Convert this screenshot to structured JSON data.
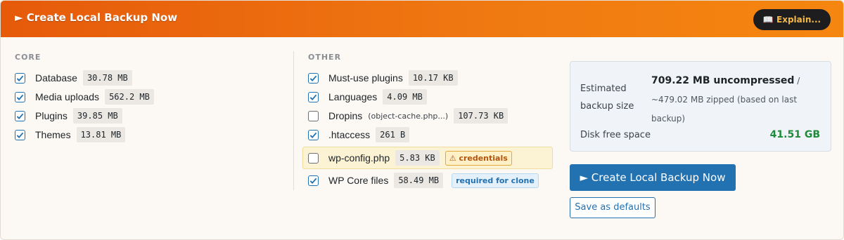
{
  "header": {
    "title": "Create Local Backup Now",
    "title_icon": "play-triangle",
    "explain_label": "Explain...",
    "explain_icon": "book-icon"
  },
  "core": {
    "heading": "CORE",
    "items": [
      {
        "label": "Database",
        "size": "30.78 MB",
        "checked": true
      },
      {
        "label": "Media uploads",
        "size": "562.2 MB",
        "checked": true
      },
      {
        "label": "Plugins",
        "size": "39.85 MB",
        "checked": true
      },
      {
        "label": "Themes",
        "size": "13.81 MB",
        "checked": true
      }
    ]
  },
  "other": {
    "heading": "OTHER",
    "items": [
      {
        "label": "Must-use plugins",
        "size": "10.17 KB",
        "checked": true
      },
      {
        "label": "Languages",
        "size": "4.09 MB",
        "checked": true
      },
      {
        "label": "Dropins",
        "sub": "(object-cache.php...)",
        "size": "107.73 KB",
        "checked": false
      },
      {
        "label": ".htaccess",
        "size": "261 B",
        "checked": true
      },
      {
        "label": "wp-config.php",
        "size": "5.83 KB",
        "checked": false,
        "badge": "⚠ credentials"
      },
      {
        "label": "WP Core files",
        "size": "58.49 MB",
        "checked": true,
        "badge": "required for clone"
      }
    ]
  },
  "summary": {
    "estimated_label_line1": "Estimated",
    "estimated_label_line2": "backup size",
    "uncompressed": "709.22 MB uncompressed",
    "separator": " /",
    "zipped_line1": "~479.02 MB zipped (based on last",
    "zipped_line2": "backup)",
    "disk_label": "Disk free space",
    "disk_value": "41.51 GB"
  },
  "actions": {
    "primary_label": "► Create Local Backup Now",
    "secondary_label": "Save as defaults"
  },
  "colors": {
    "header_start": "#e65a0a",
    "header_end": "#f5860f",
    "accent_blue": "#2271b1",
    "disk_green": "#1e8a3a",
    "warning_bg": "#fcf2d4"
  }
}
